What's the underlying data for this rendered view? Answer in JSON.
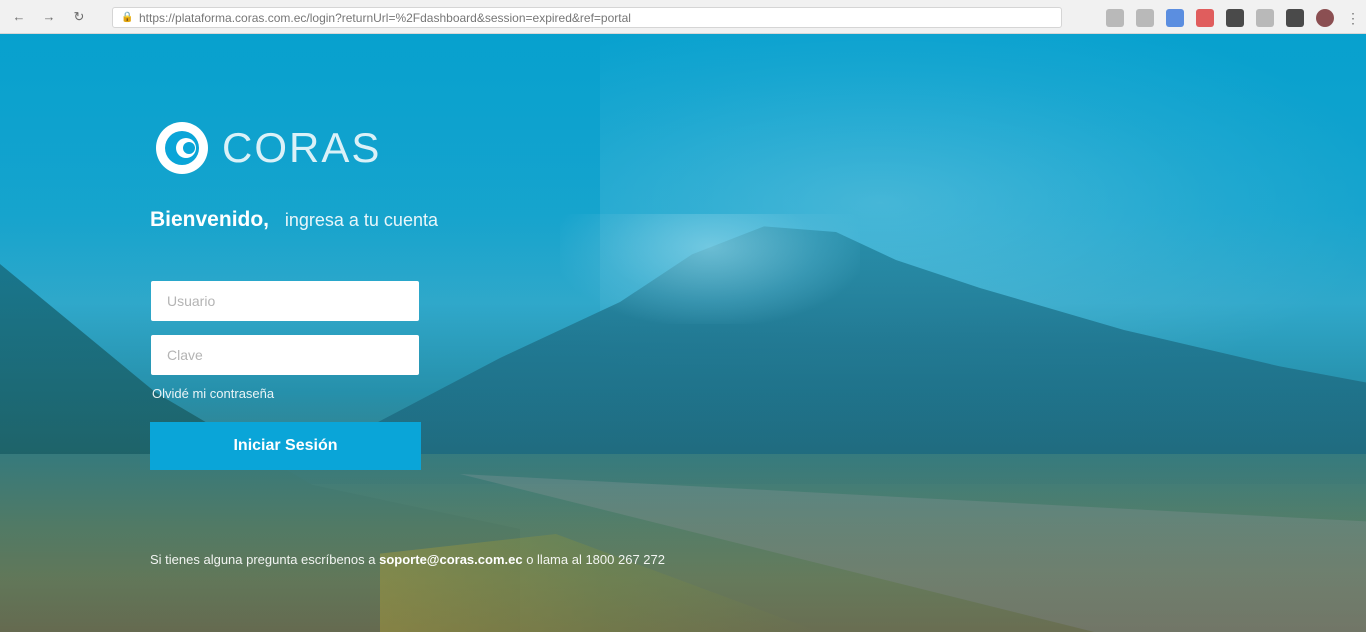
{
  "browser": {
    "back_icon": "back-arrow-icon",
    "forward_icon": "forward-arrow-icon",
    "reload_icon": "reload-icon",
    "url": "https://plataforma.coras.com.ec/login?returnUrl=%2Fdashboard&session=expired&ref=portal"
  },
  "brand": {
    "logo_text": "CORAS",
    "accent_color": "#0aa5d8"
  },
  "login": {
    "welcome_strong": "Bienvenido,",
    "welcome_light": "ingresa a tu cuenta",
    "username_placeholder": "Usuario",
    "password_placeholder": "Clave",
    "forgot_label": "Olvidé mi contraseña",
    "submit_label": "Iniciar Sesión"
  },
  "footer": {
    "prefix": "Si tienes alguna pregunta escríbenos a",
    "link": "soporte@coras.com.ec",
    "suffix": "o llama al 1800 267 272"
  }
}
